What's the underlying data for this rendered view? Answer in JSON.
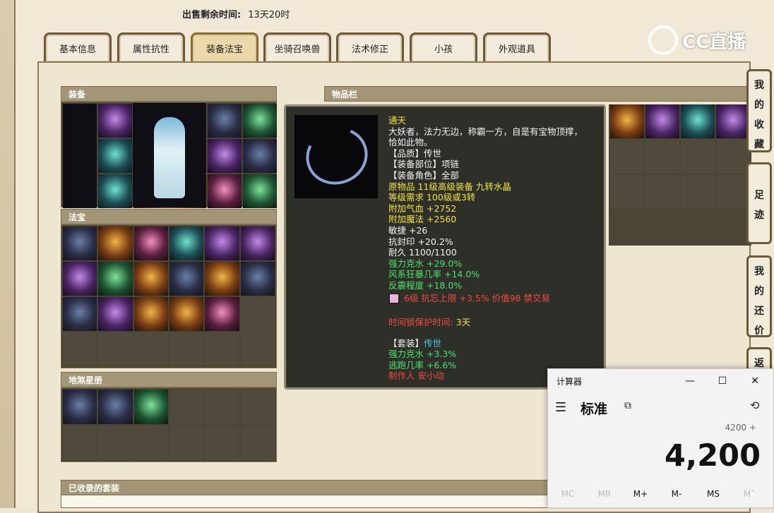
{
  "sale": {
    "label": "出售剩余时间:",
    "value": "13天20时"
  },
  "tabs": [
    {
      "label": "基本信息"
    },
    {
      "label": "属性抗性"
    },
    {
      "label": "装备法宝"
    },
    {
      "label": "坐骑召唤兽"
    },
    {
      "label": "法术修正"
    },
    {
      "label": "小孩"
    },
    {
      "label": "外观道具"
    }
  ],
  "active_tab": "装备法宝",
  "logo": {
    "text": "CC直播"
  },
  "panels": {
    "equipment": "装备",
    "fabao": "法宝",
    "dishaxingce": "地煞星册",
    "inventory": "物品栏",
    "collected_sets": "已收录的套装"
  },
  "tooltip": {
    "name": "通天",
    "desc1": "大妖者，法力无边，称霸一方，自是有宝物顶撑，",
    "desc2": "恰如此物。",
    "quality": "【品质】传世",
    "slot": "【装备部位】项链",
    "role": "【装备角色】全部",
    "origin": "原物品 11级高级装备 九转水晶",
    "level_req": "等级需求 100级或3转",
    "hp": "附加气血 +2752",
    "mp": "附加魔法 +2560",
    "agility": "敏捷 +26",
    "seal_resist": "抗封印 +20.2%",
    "durability": "耐久 1100/1100",
    "counter_water": "强力克水 +29.0%",
    "wind_crit": "风系狂暴几率 +14.0%",
    "reflect": "反震程度 +18.0%",
    "gem_line": "6级 抗忘上限 +3.5% 价值98 禁交易",
    "protect_label": "时间锁保护时间:",
    "protect_value": "3天",
    "set_label": "【套装】",
    "set_value": "传世",
    "set_counter_water": "强力克水 +3.3%",
    "set_escape": "逃跑几率 +6.6%",
    "maker": "制作人 安小动"
  },
  "side_buttons": [
    "我的收藏",
    "足迹",
    "我的还价",
    "返"
  ],
  "calculator": {
    "title": "计算器",
    "mode": "标准",
    "expression": "4200 +",
    "display": "4,200",
    "memory_buttons": [
      "MC",
      "MR",
      "M+",
      "M-",
      "MS",
      "M˅"
    ]
  }
}
